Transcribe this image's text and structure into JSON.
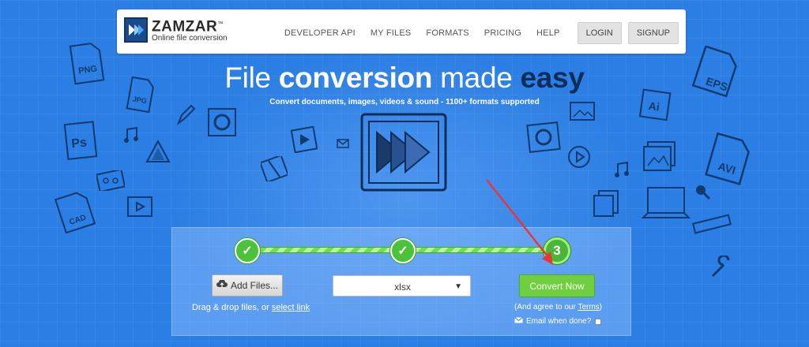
{
  "brand": {
    "name": "ZAMZAR",
    "trademark": "™",
    "tagline": "Online file conversion",
    "logo_icon": "fast-forward-icon"
  },
  "nav": {
    "links": [
      "DEVELOPER API",
      "MY FILES",
      "FORMATS",
      "PRICING",
      "HELP"
    ],
    "login_label": "LOGIN",
    "signup_label": "SIGNUP"
  },
  "hero": {
    "title_part1": "File ",
    "title_part2": "conversion",
    "title_part3": " made ",
    "title_part4": "easy",
    "subtitle": "Convert documents, images, videos & sound - 1100+ formats supported",
    "decor_labels": [
      "PNG",
      "JPG",
      "Ps",
      "CAD",
      "EPS",
      "AVI",
      "Ai"
    ]
  },
  "converter": {
    "steps": [
      {
        "state": "done",
        "label": "✓"
      },
      {
        "state": "done",
        "label": "✓"
      },
      {
        "state": "current",
        "label": "3"
      }
    ],
    "add_files_label": "Add Files...",
    "drag_text": "Drag & drop files, or ",
    "select_link": "select link",
    "format_value": "xlsx",
    "select_arrow": "▼",
    "convert_label": "Convert Now",
    "agree_prefix": "(And agree to our ",
    "terms_link": "Terms",
    "agree_suffix": ")",
    "email_label": "Email when done?",
    "email_checked": false
  },
  "colors": {
    "background": "#2b7ee3",
    "convert_button": "#6fcf3e",
    "annotation_arrow": "#e8373b"
  }
}
